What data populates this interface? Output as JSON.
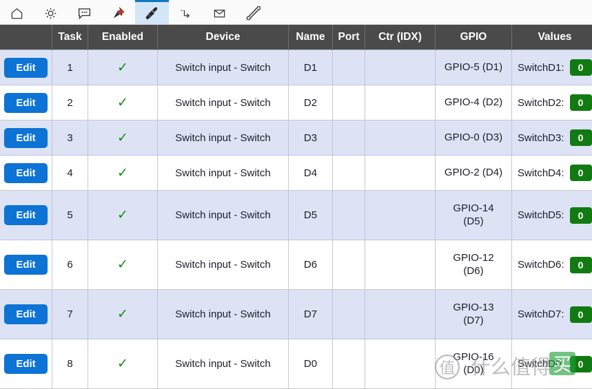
{
  "toolbar": {
    "items": [
      {
        "icon": "home-icon",
        "name": "tab-home",
        "active": false
      },
      {
        "icon": "gear-icon",
        "name": "tab-config",
        "active": false
      },
      {
        "icon": "chat-icon",
        "name": "tab-controller",
        "active": false
      },
      {
        "icon": "pin-icon",
        "name": "tab-hardware",
        "active": false
      },
      {
        "icon": "plug-icon",
        "name": "tab-devices",
        "active": true
      },
      {
        "icon": "rules-icon",
        "name": "tab-rules",
        "active": false
      },
      {
        "icon": "mail-icon",
        "name": "tab-notifications",
        "active": false
      },
      {
        "icon": "wrench-icon",
        "name": "tab-tools",
        "active": false
      }
    ],
    "active_color": "#d3e6f7",
    "active_border_color": "#1178c4"
  },
  "table": {
    "headers": [
      "",
      "Task",
      "Enabled",
      "Device",
      "Name",
      "Port",
      "Ctr (IDX)",
      "GPIO",
      "Values"
    ],
    "header_bg": "#4a4a4a",
    "alt_row_bg": "#dde3f5",
    "edit_label": "Edit",
    "enabled_mark": "✓",
    "badge_color": "#127a12",
    "edit_button_color": "#0d73d4",
    "rows": [
      {
        "task": "1",
        "enabled": "✓",
        "device": "Switch input - Switch",
        "name": "D1",
        "port": "",
        "ctr": "",
        "gpio": "GPIO-5 (D1)",
        "value_label": "SwitchD1:",
        "value": "0",
        "tall": false
      },
      {
        "task": "2",
        "enabled": "✓",
        "device": "Switch input - Switch",
        "name": "D2",
        "port": "",
        "ctr": "",
        "gpio": "GPIO-4 (D2)",
        "value_label": "SwitchD2:",
        "value": "0",
        "tall": false
      },
      {
        "task": "3",
        "enabled": "✓",
        "device": "Switch input - Switch",
        "name": "D3",
        "port": "",
        "ctr": "",
        "gpio": "GPIO-0 (D3)",
        "value_label": "SwitchD3:",
        "value": "0",
        "tall": false
      },
      {
        "task": "4",
        "enabled": "✓",
        "device": "Switch input - Switch",
        "name": "D4",
        "port": "",
        "ctr": "",
        "gpio": "GPIO-2 (D4)",
        "value_label": "SwitchD4:",
        "value": "0",
        "tall": false
      },
      {
        "task": "5",
        "enabled": "✓",
        "device": "Switch input - Switch",
        "name": "D5",
        "port": "",
        "ctr": "",
        "gpio": "GPIO-14 (D5)",
        "value_label": "SwitchD5:",
        "value": "0",
        "tall": true
      },
      {
        "task": "6",
        "enabled": "✓",
        "device": "Switch input - Switch",
        "name": "D6",
        "port": "",
        "ctr": "",
        "gpio": "GPIO-12 (D6)",
        "value_label": "SwitchD6:",
        "value": "0",
        "tall": true
      },
      {
        "task": "7",
        "enabled": "✓",
        "device": "Switch input - Switch",
        "name": "D7",
        "port": "",
        "ctr": "",
        "gpio": "GPIO-13 (D7)",
        "value_label": "SwitchD7:",
        "value": "0",
        "tall": true
      },
      {
        "task": "8",
        "enabled": "✓",
        "device": "Switch input - Switch",
        "name": "D0",
        "port": "",
        "ctr": "",
        "gpio": "GPIO-16 (D0)",
        "value_label": "SwitchD0:",
        "value": "0",
        "tall": true
      }
    ]
  },
  "watermark": {
    "text": "什么值得买",
    "badge_text": "买"
  }
}
